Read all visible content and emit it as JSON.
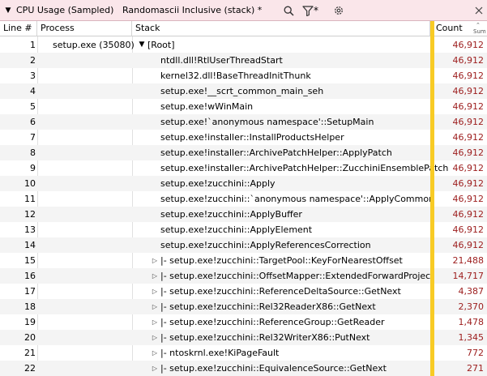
{
  "titlebar": {
    "title": "CPU Usage (Sampled)",
    "preset": "Randomascii Inclusive (stack) *",
    "filter_suffix": "*",
    "collapse_glyph": "▼"
  },
  "columns": {
    "line": "Line #",
    "process": "Process",
    "stack": "Stack",
    "count": "Count",
    "count_sort_glyph": "⌃",
    "count_agg": "Sum"
  },
  "rows": [
    {
      "line": "1",
      "process": "setup.exe (35080)",
      "expander": "open",
      "indent": 0,
      "stack": "[Root]",
      "count": "46,912"
    },
    {
      "line": "2",
      "process": "",
      "expander": "none",
      "indent": 1,
      "stack": "ntdll.dll!RtlUserThreadStart",
      "count": "46,912"
    },
    {
      "line": "3",
      "process": "",
      "expander": "none",
      "indent": 1,
      "stack": "kernel32.dll!BaseThreadInitThunk",
      "count": "46,912"
    },
    {
      "line": "4",
      "process": "",
      "expander": "none",
      "indent": 1,
      "stack": "setup.exe!__scrt_common_main_seh",
      "count": "46,912"
    },
    {
      "line": "5",
      "process": "",
      "expander": "none",
      "indent": 1,
      "stack": "setup.exe!wWinMain",
      "count": "46,912"
    },
    {
      "line": "6",
      "process": "",
      "expander": "none",
      "indent": 1,
      "stack": "setup.exe!`anonymous namespace'::SetupMain",
      "count": "46,912"
    },
    {
      "line": "7",
      "process": "",
      "expander": "none",
      "indent": 1,
      "stack": "setup.exe!installer::InstallProductsHelper",
      "count": "46,912"
    },
    {
      "line": "8",
      "process": "",
      "expander": "none",
      "indent": 1,
      "stack": "setup.exe!installer::ArchivePatchHelper::ApplyPatch",
      "count": "46,912"
    },
    {
      "line": "9",
      "process": "",
      "expander": "none",
      "indent": 1,
      "stack": "setup.exe!installer::ArchivePatchHelper::ZucchiniEnsemblePatch",
      "count": "46,912"
    },
    {
      "line": "10",
      "process": "",
      "expander": "none",
      "indent": 1,
      "stack": "setup.exe!zucchini::Apply",
      "count": "46,912"
    },
    {
      "line": "11",
      "process": "",
      "expander": "none",
      "indent": 1,
      "stack": "setup.exe!zucchini::`anonymous namespace'::ApplyCommon",
      "count": "46,912"
    },
    {
      "line": "12",
      "process": "",
      "expander": "none",
      "indent": 1,
      "stack": "setup.exe!zucchini::ApplyBuffer",
      "count": "46,912"
    },
    {
      "line": "13",
      "process": "",
      "expander": "none",
      "indent": 1,
      "stack": "setup.exe!zucchini::ApplyElement",
      "count": "46,912"
    },
    {
      "line": "14",
      "process": "",
      "expander": "none",
      "indent": 1,
      "stack": "setup.exe!zucchini::ApplyReferencesCorrection",
      "count": "46,912"
    },
    {
      "line": "15",
      "process": "",
      "expander": "closed",
      "indent": 1,
      "stack": "|- setup.exe!zucchini::TargetPool::KeyForNearestOffset",
      "count": "21,488"
    },
    {
      "line": "16",
      "process": "",
      "expander": "closed",
      "indent": 1,
      "stack": "|- setup.exe!zucchini::OffsetMapper::ExtendedForwardProject",
      "count": "14,717"
    },
    {
      "line": "17",
      "process": "",
      "expander": "closed",
      "indent": 1,
      "stack": "|- setup.exe!zucchini::ReferenceDeltaSource::GetNext",
      "count": "4,387"
    },
    {
      "line": "18",
      "process": "",
      "expander": "closed",
      "indent": 1,
      "stack": "|- setup.exe!zucchini::Rel32ReaderX86::GetNext",
      "count": "2,370"
    },
    {
      "line": "19",
      "process": "",
      "expander": "closed",
      "indent": 1,
      "stack": "|- setup.exe!zucchini::ReferenceGroup::GetReader",
      "count": "1,478"
    },
    {
      "line": "20",
      "process": "",
      "expander": "closed",
      "indent": 1,
      "stack": "|- setup.exe!zucchini::Rel32WriterX86::PutNext",
      "count": "1,345"
    },
    {
      "line": "21",
      "process": "",
      "expander": "closed",
      "indent": 1,
      "stack": "|- ntoskrnl.exe!KiPageFault",
      "count": "772"
    },
    {
      "line": "22",
      "process": "",
      "expander": "closed",
      "indent": 1,
      "stack": "|- setup.exe!zucchini::EquivalenceSource::GetNext",
      "count": "271"
    }
  ],
  "colors": {
    "titlebar_bg": "#fae6ea",
    "count_text": "#9c1c1c",
    "highlight_column": "#f8cb25"
  },
  "icons": {
    "search": "search-icon",
    "filter": "filter-icon",
    "settings": "gear-icon",
    "close": "close-icon"
  }
}
